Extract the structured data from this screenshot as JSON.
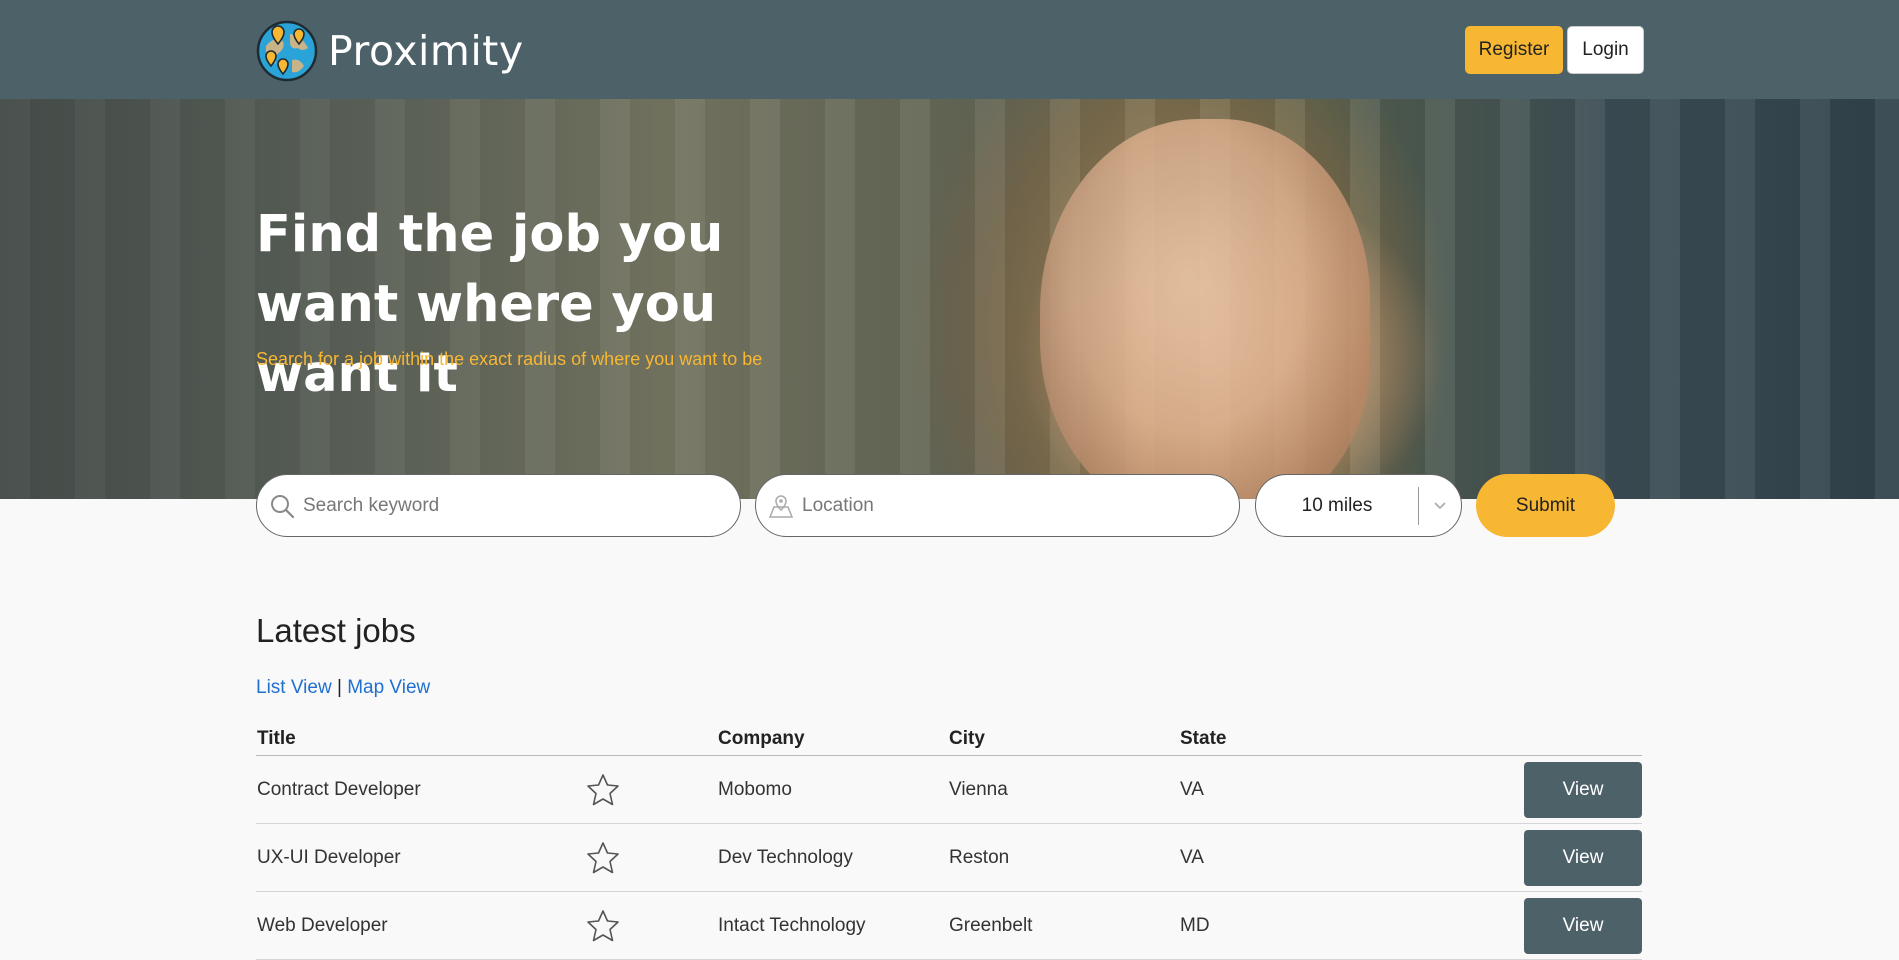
{
  "nav": {
    "brand": "Proximity",
    "register_label": "Register",
    "login_label": "Login"
  },
  "hero": {
    "title": "Find the job you want where you want it",
    "subtitle": "Search for a job within the exact radius of where you want to be"
  },
  "search": {
    "keyword_placeholder": "Search keyword",
    "location_placeholder": "Location",
    "radius_value": "10 miles",
    "submit_label": "Submit"
  },
  "jobs": {
    "heading": "Latest jobs",
    "list_view_label": "List View",
    "separator": "|",
    "map_view_label": "Map View",
    "columns": {
      "title": "Title",
      "company": "Company",
      "city": "City",
      "state": "State"
    },
    "rows": [
      {
        "title": "Contract Developer",
        "company": "Mobomo",
        "city": "Vienna",
        "state": "VA",
        "action": "View"
      },
      {
        "title": "UX-UI Developer",
        "company": "Dev Technology",
        "city": "Reston",
        "state": "VA",
        "action": "View"
      },
      {
        "title": "Web Developer",
        "company": "Intact Technology",
        "city": "Greenbelt",
        "state": "MD",
        "action": "View"
      }
    ]
  },
  "colors": {
    "navbar": "#4d6168",
    "accent": "#f7b733",
    "link": "#1f6fd1",
    "view_button": "#4d6168"
  },
  "icons": {
    "logo": "globe-map-pins-icon",
    "keyword": "search-icon",
    "location": "map-pin-icon",
    "radius": "chevron-down-icon",
    "favorite": "star-outline-icon"
  }
}
